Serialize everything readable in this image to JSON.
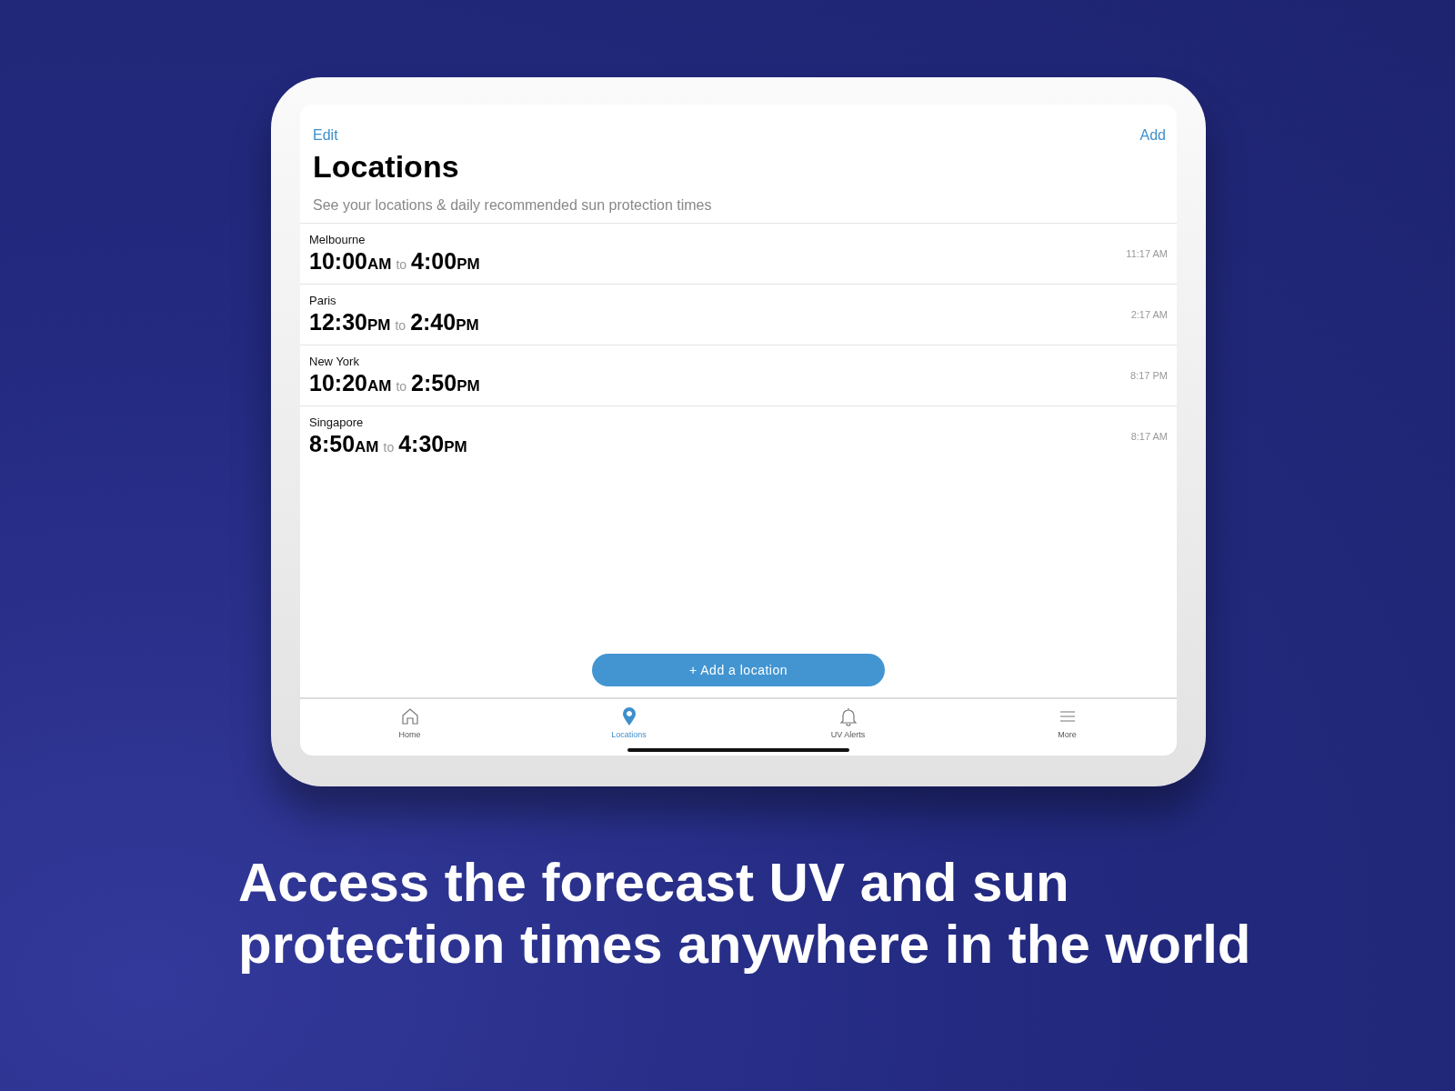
{
  "nav": {
    "left": "Edit",
    "right": "Add"
  },
  "title": "Locations",
  "subtitle": "See your locations & daily recommended sun protection times",
  "locations": [
    {
      "name": "Melbourne",
      "start_time": "10:00",
      "start_period": "AM",
      "connector": "to",
      "end_time": "4:00",
      "end_period": "PM",
      "local_time": "11:17 AM"
    },
    {
      "name": "Paris",
      "start_time": "12:30",
      "start_period": "PM",
      "connector": "to",
      "end_time": "2:40",
      "end_period": "PM",
      "local_time": "2:17 AM"
    },
    {
      "name": "New York",
      "start_time": "10:20",
      "start_period": "AM",
      "connector": "to",
      "end_time": "2:50",
      "end_period": "PM",
      "local_time": "8:17 PM"
    },
    {
      "name": "Singapore",
      "start_time": "8:50",
      "start_period": "AM",
      "connector": "to",
      "end_time": "4:30",
      "end_period": "PM",
      "local_time": "8:17 AM"
    }
  ],
  "add_button": "+ Add a location",
  "tabs": [
    {
      "kind": "home",
      "label": "Home",
      "selected": false
    },
    {
      "kind": "pin",
      "label": "Locations",
      "selected": true
    },
    {
      "kind": "bell",
      "label": "UV Alerts",
      "selected": false
    },
    {
      "kind": "menu",
      "label": "More",
      "selected": false
    }
  ],
  "headline": "Access the forecast UV and sun protection times anywhere in the world"
}
